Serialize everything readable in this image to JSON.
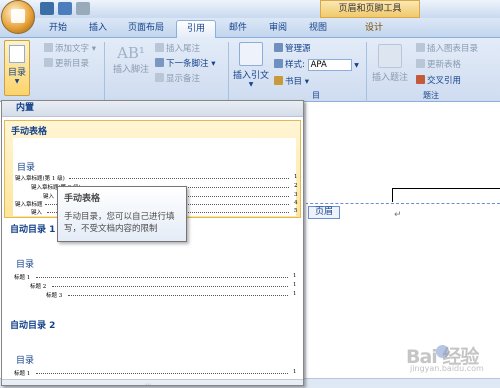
{
  "titlebar": {
    "context_title": "页眉和页脚工具"
  },
  "tabs": [
    {
      "label": "开始"
    },
    {
      "label": "插入"
    },
    {
      "label": "页面布局"
    },
    {
      "label": "引用"
    },
    {
      "label": "邮件"
    },
    {
      "label": "审阅"
    },
    {
      "label": "视图"
    },
    {
      "label": "设计"
    }
  ],
  "ribbon": {
    "toc_button": "目录",
    "add_text": "添加文字",
    "update_toc": "更新目录",
    "insert_footnote": "插入脚注",
    "insert_endnote": "插入尾注",
    "next_footnote": "下一条脚注",
    "show_notes": "显示备注",
    "insert_citation": "插入引文",
    "manage_sources": "管理源",
    "style_label": "样式:",
    "style_value": "APA",
    "bibliography": "书目",
    "citations_group_suffix": "目",
    "insert_caption": "插入题注",
    "insert_table_of_figures": "插入图表目录",
    "update_table": "更新表格",
    "cross_reference": "交叉引用",
    "captions_group": "题注"
  },
  "gallery": {
    "header": "内置",
    "entries": [
      {
        "title": "手动表格",
        "toc_heading": "目录",
        "rows": [
          {
            "text": "键入章标题(第 1 级)",
            "num": "1"
          },
          {
            "text": "键入章标题(第 2 级)",
            "num": "2"
          },
          {
            "text": "键入",
            "num": "3"
          },
          {
            "text": "键入章标题",
            "num": "4"
          },
          {
            "text": "键入",
            "num": "5"
          }
        ]
      },
      {
        "title": "自动目录 1",
        "toc_heading": "目录",
        "rows": [
          {
            "text": "标题 1",
            "num": "1"
          },
          {
            "text": "标题 2",
            "num": "1"
          },
          {
            "text": "标题 3",
            "num": "1"
          }
        ]
      },
      {
        "title": "自动目录 2",
        "toc_heading": "目录",
        "rows": [
          {
            "text": "标题 1",
            "num": "1"
          }
        ]
      }
    ]
  },
  "tooltip": {
    "title": "手动表格",
    "body": "手动目录，您可以自己进行填写，不受文档内容的限制"
  },
  "document": {
    "header_tag": "页眉",
    "paragraph_mark": "↵"
  },
  "watermark": {
    "main": "Bai 经验",
    "sub": "jingyan.baidu.com"
  }
}
